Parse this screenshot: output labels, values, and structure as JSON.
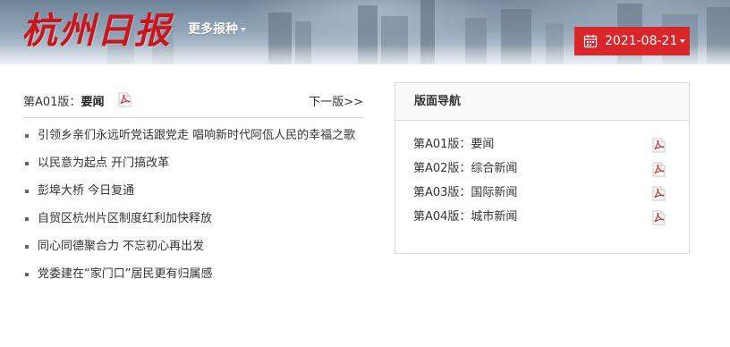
{
  "header": {
    "logo_text": "杭州日报",
    "more_papers_label": "更多报种",
    "date_value": "2021-08-21",
    "brand_color": "#c8161d",
    "date_button_color": "#d9262b"
  },
  "page": {
    "label_prefix": "第A01版：",
    "name": "要闻",
    "next_label": "下一版>>"
  },
  "articles": [
    "引领乡亲们永远听党话跟党走 唱响新时代阿佤人民的幸福之歌",
    "以民意为起点 开门搞改革",
    "彭埠大桥 今日复通",
    "自贸区杭州片区制度红利加快释放",
    "同心同德聚合力 不忘初心再出发",
    "党委建在“家门口”居民更有归属感"
  ],
  "nav": {
    "title": "版面导航",
    "items": [
      "第A01版：要闻",
      "第A02版：综合新闻",
      "第A03版：国际新闻",
      "第A04版：城市新闻"
    ]
  },
  "icons": {
    "calendar": "calendar-icon",
    "pdf": "pdf-icon",
    "caret": "caret-down-icon"
  }
}
